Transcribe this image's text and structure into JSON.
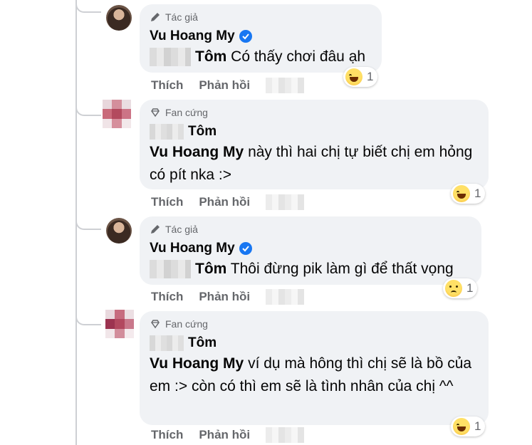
{
  "comments": [
    {
      "badge": "Tác giả",
      "badge_icon": "pen-icon",
      "author": "Vu Hoang My",
      "verified": true,
      "mention": "Tôm",
      "text": "Có thấy chơi đâu ạh",
      "reaction_icon": "laugh-emoji-icon",
      "reaction_count": "1",
      "like_label": "Thích",
      "reply_label": "Phản hồi"
    },
    {
      "badge": "Fan cứng",
      "badge_icon": "diamond-icon",
      "author_hidden": true,
      "mention": "Tôm",
      "mention_name": "Vu Hoang My",
      "text": "này thì hai chị tự biết chị em hỏng có pít nka :>",
      "reaction_icon": "laugh-emoji-icon",
      "reaction_count": "1",
      "like_label": "Thích",
      "reply_label": "Phản hồi"
    },
    {
      "badge": "Tác giả",
      "badge_icon": "pen-icon",
      "author": "Vu Hoang My",
      "verified": true,
      "mention": "Tôm",
      "text": "Thôi đừng pik làm gì để thất vọng",
      "reaction_icon": "sad-emoji-icon",
      "reaction_count": "1",
      "like_label": "Thích",
      "reply_label": "Phản hồi"
    },
    {
      "badge": "Fan cứng",
      "badge_icon": "diamond-icon",
      "author_hidden": true,
      "mention": "Tôm",
      "mention_name": "Vu Hoang My",
      "text": "ví dụ mà hông thì chị sẽ là bồ của em :> còn có thì em sẽ là tình nhân của chị ^^",
      "reaction_icon": "laugh-emoji-icon",
      "reaction_count": "1",
      "like_label": "Thích",
      "reply_label": "Phản hồi"
    }
  ],
  "colors": {
    "bubble": "#f0f2f5",
    "meta_text": "#65676b",
    "verified": "#1877f2",
    "thread_line": "#ced0d4"
  }
}
